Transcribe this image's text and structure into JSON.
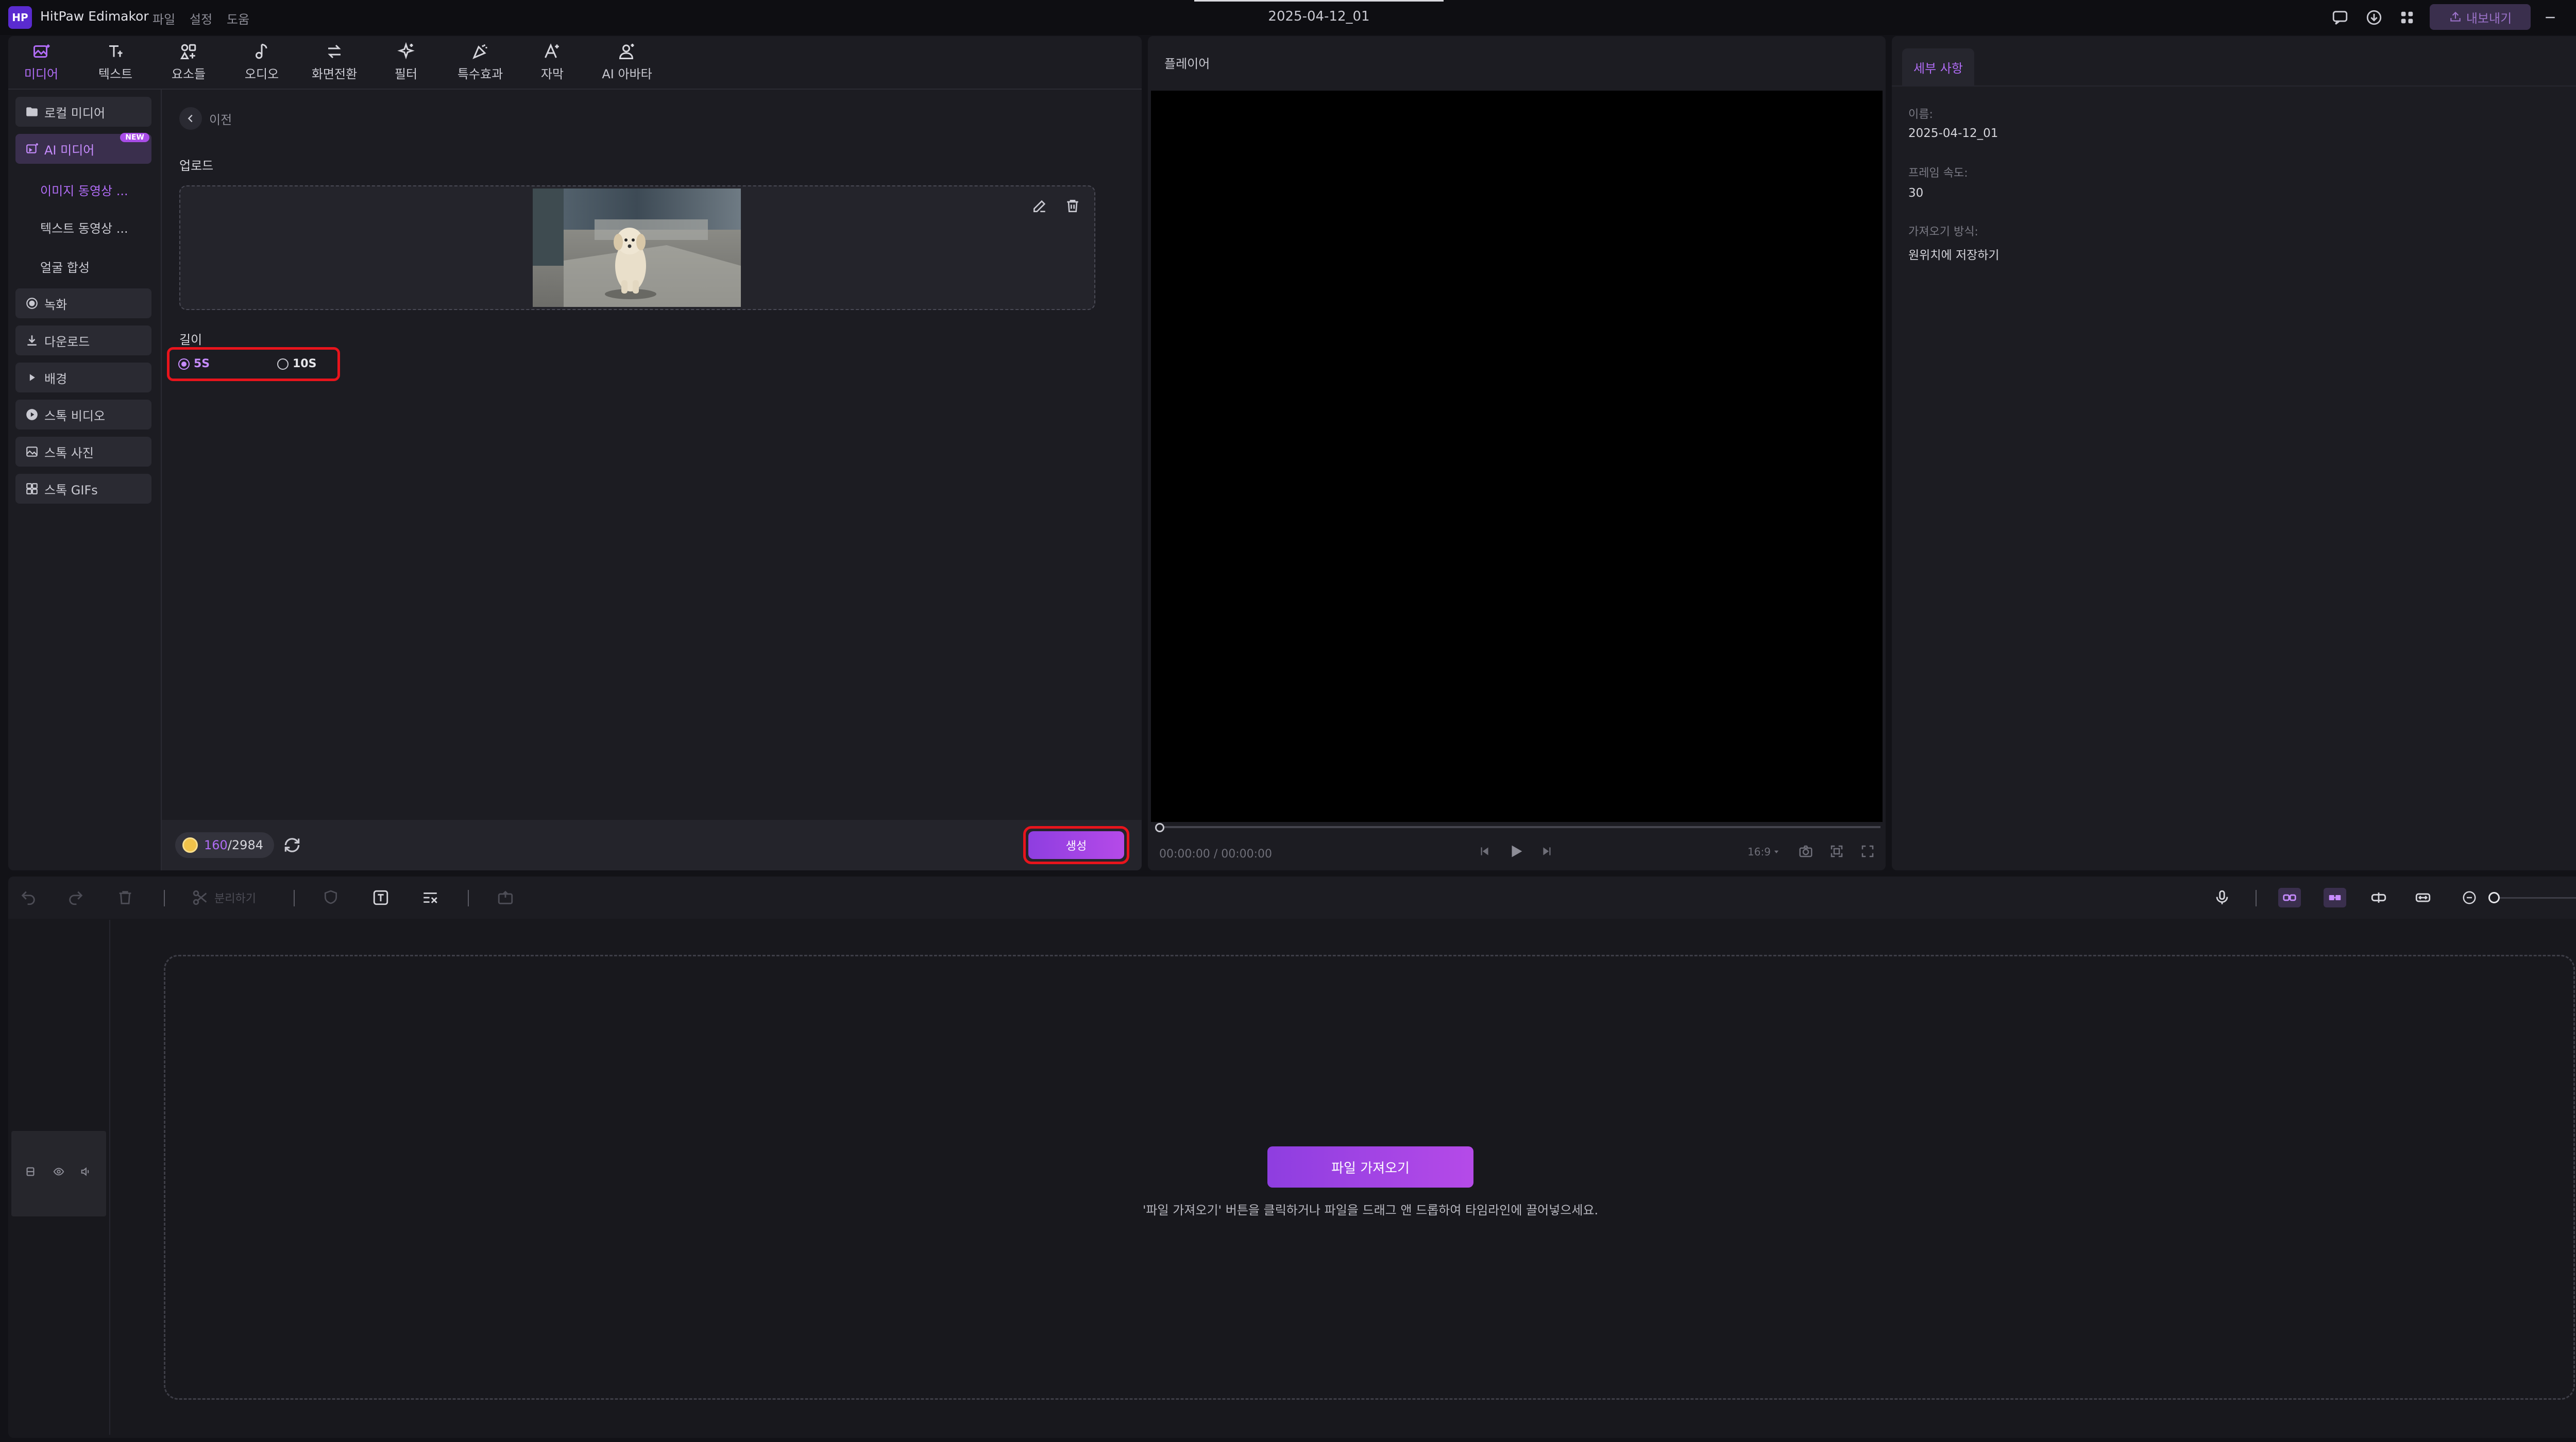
{
  "app": {
    "name": "HitPaw Edimakor",
    "menu": [
      "파일",
      "설정",
      "도움"
    ],
    "project_title": "2025-04-12_01",
    "export_label": "내보내기"
  },
  "toolbar": {
    "tabs": [
      {
        "label": "미디어",
        "icon": "media-icon",
        "active": true
      },
      {
        "label": "텍스트",
        "icon": "text-icon"
      },
      {
        "label": "요소들",
        "icon": "elements-icon"
      },
      {
        "label": "오디오",
        "icon": "audio-icon"
      },
      {
        "label": "화면전환",
        "icon": "transition-icon"
      },
      {
        "label": "필터",
        "icon": "filter-icon"
      },
      {
        "label": "특수효과",
        "icon": "effects-icon"
      },
      {
        "label": "자막",
        "icon": "subtitle-icon"
      },
      {
        "label": "AI 아바타",
        "icon": "ai-avatar-icon"
      }
    ]
  },
  "sidebar": {
    "items": [
      {
        "label": "로컬 미디어",
        "icon": "folder-icon"
      },
      {
        "label": "AI 미디어",
        "icon": "ai-media-icon",
        "badge": "NEW",
        "active": true
      },
      {
        "label": "이미지 동영상 ...",
        "sub": true,
        "active": true
      },
      {
        "label": "텍스트 동영상 ...",
        "sub": true
      },
      {
        "label": "얼굴 합성",
        "sub": true
      },
      {
        "label": "녹화",
        "icon": "record-icon"
      },
      {
        "label": "다운로드",
        "icon": "download-icon"
      },
      {
        "label": "배경",
        "icon": "triangle-right-icon"
      },
      {
        "label": "스톡 비디오",
        "icon": "play-icon"
      },
      {
        "label": "스톡 사진",
        "icon": "photo-icon"
      },
      {
        "label": "스톡 GIFs",
        "icon": "gif-icon"
      }
    ]
  },
  "content": {
    "back_label": "이전",
    "upload_label": "업로드",
    "duration_label": "길이",
    "durations": [
      {
        "label": "5S",
        "selected": true
      },
      {
        "label": "10S",
        "selected": false
      }
    ],
    "credits_used": "160",
    "credits_total": "/2984",
    "generate_label": "생성"
  },
  "player": {
    "header": "플레이어",
    "current_time": "00:00:00",
    "total_time": "/ 00:00:00",
    "aspect": "16:9",
    "progress": 0
  },
  "details": {
    "tab_label": "세부 사항",
    "fields": [
      {
        "label": "이름:",
        "value": "2025-04-12_01"
      },
      {
        "label": "프레임 속도:",
        "value": "30"
      },
      {
        "label": "가져오기 방식:",
        "value": "원위치에 저장하기"
      }
    ]
  },
  "timeline": {
    "split_label": "분리하기",
    "import_button": "파일 가져오기",
    "hint": "'파일 가져오기' 버튼을 클릭하거나 파일을 드래그 앤 드롭하여 타임라인에 끌어넣으세요.",
    "zoom_level": 0
  },
  "colors": {
    "accent": "#a94de8",
    "accent_light": "#c78cff",
    "highlight_box": "#e8141c",
    "panel": "#1c1c22",
    "background": "#121217"
  }
}
